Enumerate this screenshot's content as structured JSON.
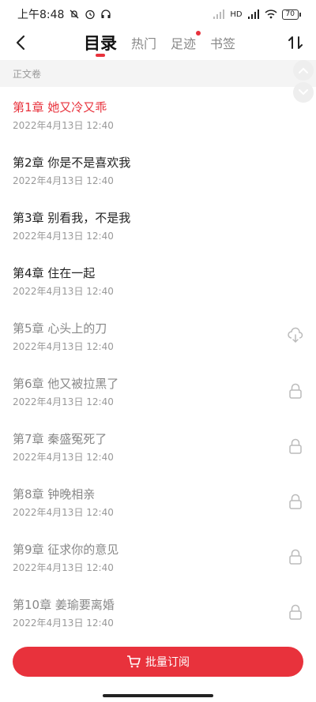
{
  "status_bar": {
    "time": "上午8:48",
    "network": "HD",
    "battery": "70"
  },
  "nav": {
    "tabs": [
      {
        "label": "目录",
        "active": true
      },
      {
        "label": "热门",
        "active": false
      },
      {
        "label": "足迹",
        "active": false,
        "badge": true
      },
      {
        "label": "书签",
        "active": false
      }
    ]
  },
  "section": {
    "title": "正文卷"
  },
  "chapters": [
    {
      "title": "第1章 她又冷又乖",
      "date": "2022年4月13日 12:40",
      "state": "current"
    },
    {
      "title": "第2章 你是不是喜欢我",
      "date": "2022年4月13日 12:40",
      "state": "read"
    },
    {
      "title": "第3章 别看我，不是我",
      "date": "2022年4月13日 12:40",
      "state": "read"
    },
    {
      "title": "第4章 住在一起",
      "date": "2022年4月13日 12:40",
      "state": "read"
    },
    {
      "title": "第5章 心头上的刀",
      "date": "2022年4月13日 12:40",
      "state": "cloud"
    },
    {
      "title": "第6章 他又被拉黑了",
      "date": "2022年4月13日 12:40",
      "state": "locked"
    },
    {
      "title": "第7章 秦盛冤死了",
      "date": "2022年4月13日 12:40",
      "state": "locked"
    },
    {
      "title": "第8章 钟晚相亲",
      "date": "2022年4月13日 12:40",
      "state": "locked"
    },
    {
      "title": "第9章 征求你的意见",
      "date": "2022年4月13日 12:40",
      "state": "locked"
    },
    {
      "title": "第10章 姜瑜要离婚",
      "date": "2022年4月13日 12:40",
      "state": "locked"
    }
  ],
  "subscribe": {
    "label": "批量订阅"
  },
  "colors": {
    "accent": "#e8323c",
    "muted_text": "#888888",
    "section_bg": "#f4f4f4"
  },
  "icons": [
    "back-arrow-icon",
    "sort-icon",
    "cloud-download-icon",
    "lock-icon",
    "cart-icon",
    "chevron-up-icon",
    "chevron-down-icon"
  ]
}
